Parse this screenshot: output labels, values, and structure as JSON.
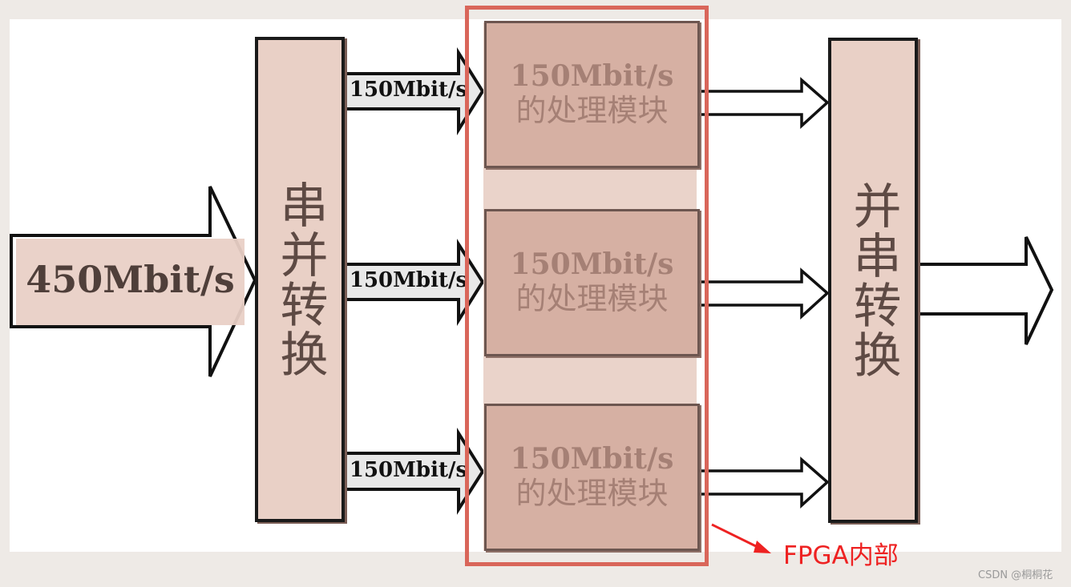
{
  "input_rate": "450Mbit/s",
  "branch_rate": "150Mbit/s",
  "serial_to_parallel": "串并转换",
  "parallel_to_serial": "并串转换",
  "modules": [
    {
      "rate": "150Mbit/s",
      "label": "的处理模块"
    },
    {
      "rate": "150Mbit/s",
      "label": "的处理模块"
    },
    {
      "rate": "150Mbit/s",
      "label": "的处理模块"
    }
  ],
  "fpga_caption": "FPGA内部",
  "watermark": "CSDN @桐桐花",
  "colors": {
    "block_fill": "#e9d0c6",
    "module_fill": "#d6b0a3",
    "fpga_frame": "#d9665a",
    "caption_red": "#ee2222"
  }
}
